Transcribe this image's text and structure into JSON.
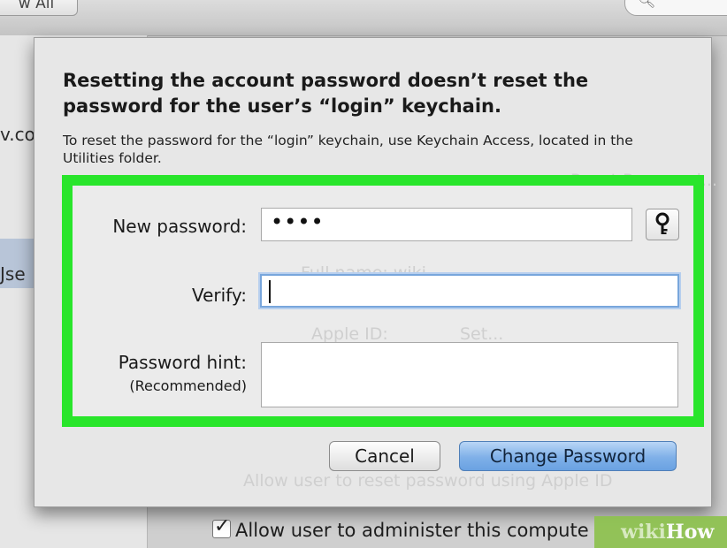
{
  "background": {
    "show_all_label": "w All",
    "sidebar_fragments": [
      "v.co",
      "Jse"
    ],
    "ghost_labels": {
      "reset_password": "Reset Password...",
      "full_name": "Full name: wiki",
      "apple_id": "Apple ID:",
      "set": "Set...",
      "allow_reset": "Allow user to reset password using Apple ID"
    },
    "administer_checkbox_label": "Allow user to administer this compute",
    "administer_checked": true
  },
  "dialog": {
    "title": "Resetting the account password doesn’t reset the password for the user’s “login” keychain.",
    "message": "To reset the password for the “login” keychain, use Keychain Access, located in the Utilities folder.",
    "fields": {
      "new_password_label": "New password:",
      "new_password_value": "••••",
      "verify_label": "Verify:",
      "verify_value": "",
      "hint_label": "Password hint:",
      "hint_sublabel": "(Recommended)",
      "hint_value": ""
    },
    "buttons": {
      "cancel": "Cancel",
      "change_password": "Change Password"
    }
  },
  "watermark": {
    "wiki": "wiki",
    "how": "How"
  },
  "colors": {
    "highlight": "#29e52b",
    "primary_button": "#7fb0e8",
    "focus_ring": "#78a6dc"
  }
}
